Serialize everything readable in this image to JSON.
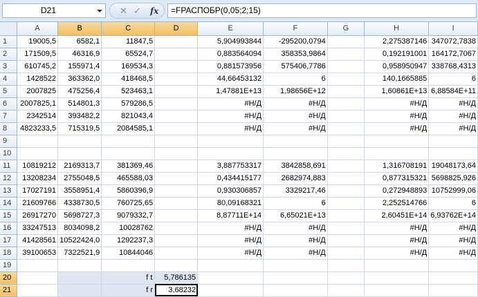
{
  "formula_bar": {
    "name_box": "D21",
    "fx_label": "fx",
    "formula": "=FРАСПОБР(0,05;2;15)"
  },
  "columns": [
    "A",
    "B",
    "C",
    "D",
    "E",
    "F",
    "G",
    "H",
    "I"
  ],
  "rows": [
    {
      "num": "1",
      "cells": [
        "19005,5",
        "6582,1",
        "11847,5",
        "",
        "5,904993844",
        "-295200,0794",
        "",
        "2,275387146",
        "347072,7838"
      ]
    },
    {
      "num": "2",
      "cells": [
        "171509,5",
        "46316,9",
        "65524,7",
        "",
        "0,883564094",
        "358353,9864",
        "",
        "0,192191001",
        "164172,7067"
      ]
    },
    {
      "num": "3",
      "cells": [
        "610745,2",
        "155971,4",
        "169534,3",
        "",
        "0,881573956",
        "575406,7786",
        "",
        "0,958950947",
        "338768,4313"
      ]
    },
    {
      "num": "4",
      "cells": [
        "1428522",
        "363362,0",
        "418468,5",
        "",
        "44,66453132",
        "6",
        "",
        "140,1665885",
        "6"
      ]
    },
    {
      "num": "5",
      "cells": [
        "2007825",
        "475256,4",
        "523463,1",
        "",
        "1,47881E+13",
        "1,98656E+12",
        "",
        "1,60861E+13",
        "6,88584E+11"
      ]
    },
    {
      "num": "6",
      "cells": [
        "2007825,1",
        "514801,3",
        "579286,5",
        "",
        "#Н/Д",
        "#Н/Д",
        "",
        "#Н/Д",
        "#Н/Д"
      ]
    },
    {
      "num": "7",
      "cells": [
        "2342514",
        "393482,2",
        "821043,4",
        "",
        "#Н/Д",
        "#Н/Д",
        "",
        "#Н/Д",
        "#Н/Д"
      ]
    },
    {
      "num": "8",
      "cells": [
        "4823233,5",
        "715319,5",
        "2084585,1",
        "",
        "#Н/Д",
        "#Н/Д",
        "",
        "#Н/Д",
        "#Н/Д"
      ]
    },
    {
      "num": "9",
      "cells": [
        "",
        "",
        "",
        "",
        "",
        "",
        "",
        "",
        ""
      ]
    },
    {
      "num": "10",
      "cells": [
        "",
        "",
        "",
        "",
        "",
        "",
        "",
        "",
        ""
      ]
    },
    {
      "num": "11",
      "cells": [
        "10819212",
        "2169313,7",
        "381369,46",
        "",
        "3,887753317",
        "3842858,691",
        "",
        "1,316708191",
        "19048173,64"
      ]
    },
    {
      "num": "12",
      "cells": [
        "13208234",
        "2755048,5",
        "465588,03",
        "",
        "0,434415177",
        "2682974,883",
        "",
        "0,877315321",
        "5698825,926"
      ]
    },
    {
      "num": "13",
      "cells": [
        "17027191",
        "3558951,4",
        "5860396,9",
        "",
        "0,930306857",
        "3329217,46",
        "",
        "0,272948893",
        "10752999,06"
      ]
    },
    {
      "num": "14",
      "cells": [
        "21609766",
        "4338730,5",
        "760725,65",
        "",
        "80,09168321",
        "6",
        "",
        "2,252514766",
        "6"
      ]
    },
    {
      "num": "15",
      "cells": [
        "26917270",
        "5698727,3",
        "9079332,7",
        "",
        "8,87711E+14",
        "6,65021E+13",
        "",
        "2,60451E+14",
        "6,93762E+14"
      ]
    },
    {
      "num": "16",
      "cells": [
        "33247513",
        "8034098,2",
        "10028762",
        "",
        "#Н/Д",
        "#Н/Д",
        "",
        "#Н/Д",
        "#Н/Д"
      ]
    },
    {
      "num": "17",
      "cells": [
        "41428561",
        "10522424,0",
        "1292237,3",
        "",
        "#Н/Д",
        "#Н/Д",
        "",
        "#Н/Д",
        "#Н/Д"
      ]
    },
    {
      "num": "18",
      "cells": [
        "39100653",
        "7322521,9",
        "10844046",
        "",
        "#Н/Д",
        "#Н/Д",
        "",
        "#Н/Д",
        "#Н/Д"
      ]
    },
    {
      "num": "19",
      "cells": [
        "",
        "",
        "",
        "",
        "",
        "",
        "",
        "",
        ""
      ]
    },
    {
      "num": "20",
      "cells": [
        "",
        "",
        "f t",
        "5,786135",
        "",
        "",
        "",
        "",
        ""
      ]
    },
    {
      "num": "21",
      "cells": [
        "",
        "",
        "f r",
        "3,68232",
        "",
        "",
        "",
        "",
        ""
      ]
    }
  ],
  "selection": {
    "active": "D21",
    "range": "B20:D21"
  },
  "colors": {
    "header_selected": "#f1c15f",
    "selection_fill": "#dfe6f1",
    "grid_line": "#d0d7e5"
  },
  "icons": [
    "chevron-down-icon",
    "cancel-icon",
    "enter-icon",
    "fx-icon"
  ]
}
